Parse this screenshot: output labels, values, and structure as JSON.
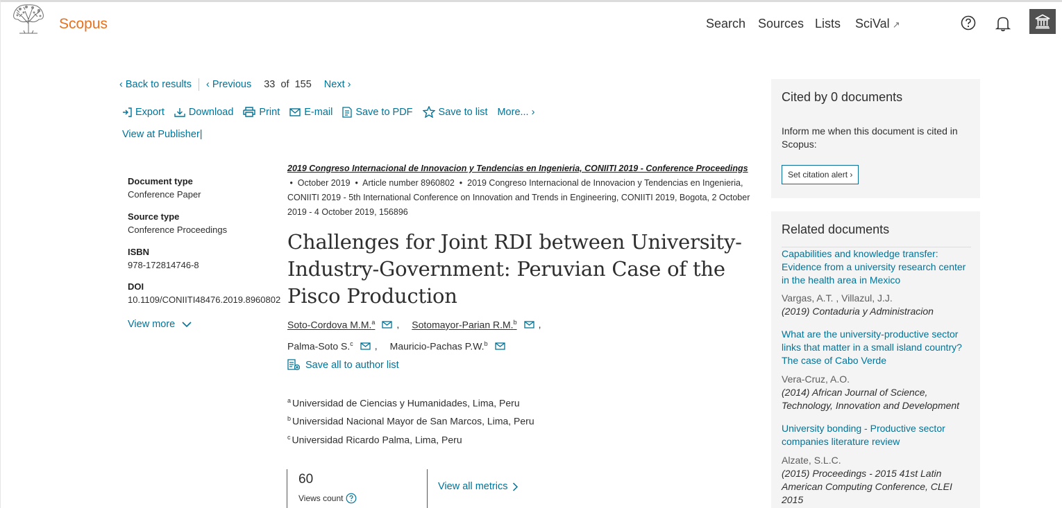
{
  "header": {
    "brand": "Scopus",
    "nav": [
      {
        "label": "Search"
      },
      {
        "label": "Sources"
      },
      {
        "label": "Lists"
      },
      {
        "label": "SciVal",
        "external_icon": "↗"
      }
    ],
    "icons": [
      "elsevier-tree-icon",
      "help-icon",
      "bell-icon",
      "institution-icon"
    ]
  },
  "nav": {
    "back": "Back to results",
    "previous": "Previous",
    "current": "33",
    "of": "of",
    "total": "155",
    "next": "Next"
  },
  "actions": {
    "export": "Export",
    "download": "Download",
    "print": "Print",
    "email": "E-mail",
    "save_pdf": "Save to PDF",
    "save_list": "Save to list",
    "more": "More..."
  },
  "publisher_link": "View at Publisher|",
  "meta": {
    "doc_type_label": "Document type",
    "doc_type": "Conference Paper",
    "source_type_label": "Source type",
    "source_type": "Conference Proceedings",
    "isbn_label": "ISBN",
    "isbn": "978-172814746-8",
    "doi_label": "DOI",
    "doi": "10.1109/CONIITI48476.2019.8960802",
    "view_more": "View more"
  },
  "source": {
    "name": "2019 Congreso Internacional de Innovacion y Tendencias en Ingenieria, CONIITI 2019 - Conference Proceedings",
    "date": "October 2019",
    "article": "Article number 8960802",
    "conference": "2019 Congreso Internacional de Innovacion y Tendencias en Ingenieria, CONIITI 2019 - 5th International Conference on Innovation and Trends in Engineering, CONIITI 2019, Bogota, 2 October 2019 - 4 October 2019, 156896"
  },
  "title_lines": [
    "Challenges for Joint RDI between University-",
    "Industry-Government: Peruvian Case of the",
    "Pisco Production"
  ],
  "authors": [
    {
      "name": "Soto-Cordova M.M.",
      "sup": "a"
    },
    {
      "name": "Sotomayor-Parian R.M.",
      "sup": "b"
    },
    {
      "name": "Palma-Soto S.",
      "sup": "c"
    },
    {
      "name": "Mauricio-Pachas P.W.",
      "sup": "b"
    }
  ],
  "save_authors": "Save all to author list",
  "affiliations": [
    {
      "sup": "a",
      "text": "Universidad de Ciencias y Humanidades, Lima, Peru"
    },
    {
      "sup": "b",
      "text": "Universidad Nacional Mayor de San Marcos, Lima, Peru"
    },
    {
      "sup": "c",
      "text": "Universidad Ricardo Palma, Lima, Peru"
    }
  ],
  "metrics": {
    "views": "60",
    "views_label": "Views count",
    "all_metrics": "View all metrics"
  },
  "cited": {
    "title": "Cited by 0 documents",
    "text": "Inform me when this document is cited in Scopus:",
    "button": "Set citation alert"
  },
  "related": {
    "title": "Related documents",
    "items": [
      {
        "title": "Capabilities and knowledge transfer: Evidence from a university research center in the health area in Mexico",
        "authors": "Vargas, A.T. , Villazul, J.J.",
        "source": "(2019) Contaduria y Administracion"
      },
      {
        "title": "What are the university-productive sector links that matter in a small island country? The case of Cabo Verde",
        "authors": "Vera-Cruz, A.O.",
        "source": "(2014) African Journal of Science, Technology, Innovation and Development"
      },
      {
        "title": "University bonding - Productive sector companies literature review",
        "authors": "Alzate, S.L.C.",
        "source": "(2015) Proceedings - 2015 41st Latin American Computing Conference, CLEI 2015"
      }
    ]
  },
  "colors": {
    "brand": "#e9711c",
    "link": "#007398",
    "panel_bg": "#f4f4f4",
    "institution_btn": "#505050"
  }
}
